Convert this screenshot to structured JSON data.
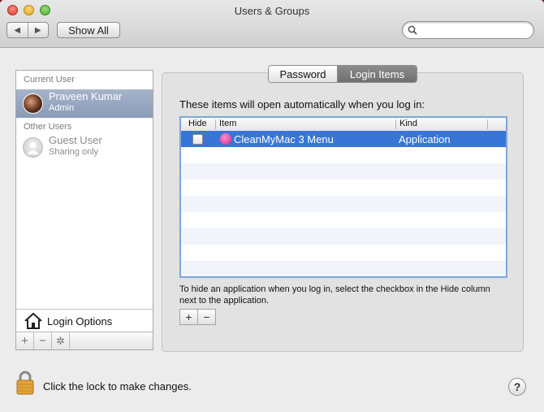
{
  "window": {
    "title": "Users & Groups"
  },
  "toolbar": {
    "back_glyph": "◀",
    "forward_glyph": "▶",
    "show_all_label": "Show All",
    "search_value": ""
  },
  "sidebar": {
    "current_section": "Current User",
    "current_user": {
      "name": "Praveen Kumar",
      "role": "Admin"
    },
    "other_section": "Other Users",
    "guest_user": {
      "name": "Guest User",
      "role": "Sharing only"
    },
    "login_options_label": "Login Options",
    "add_glyph": "+",
    "remove_glyph": "−",
    "action_glyph": "✲"
  },
  "tabs": {
    "password": "Password",
    "login_items": "Login Items",
    "selected": "Login Items"
  },
  "login_items": {
    "intro": "These items will open automatically when you log in:",
    "columns": {
      "hide": "Hide",
      "item": "Item",
      "kind": "Kind"
    },
    "rows": [
      {
        "hide": false,
        "name": "CleanMyMac 3 Menu",
        "kind": "Application",
        "icon": "cleanmymac-icon"
      }
    ],
    "hint": "To hide an application when you log in, select the checkbox in the Hide column next to the application.",
    "add_glyph": "+",
    "remove_glyph": "−"
  },
  "footer": {
    "lock_text": "Click the lock to make changes.",
    "help_glyph": "?"
  },
  "colors": {
    "selection": "#3875d7",
    "sidebar_selection": "#8a9bb7",
    "table_focus": "#7ea6d9"
  }
}
